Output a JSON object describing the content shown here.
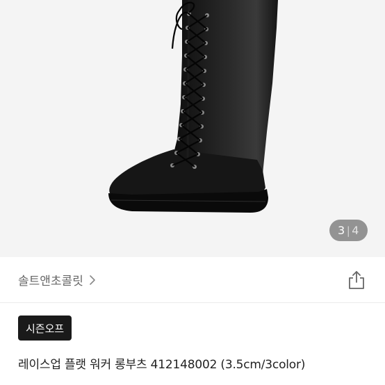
{
  "gallery": {
    "current_page": "3",
    "separator": "|",
    "total_pages": "4"
  },
  "store": {
    "name": "솔트앤초콜릿",
    "chevron_icon": "chevron-right-icon",
    "share_icon": "share-icon"
  },
  "product": {
    "badge": "시즌오프",
    "title": "레이스업 플랫 워커 롱부츠 412148002 (3.5cm/3color)"
  },
  "colors": {
    "badge_bg": "#1a1a1a",
    "gallery_bg": "#f4f4f4",
    "indicator_bg": "#6e6e6e"
  }
}
